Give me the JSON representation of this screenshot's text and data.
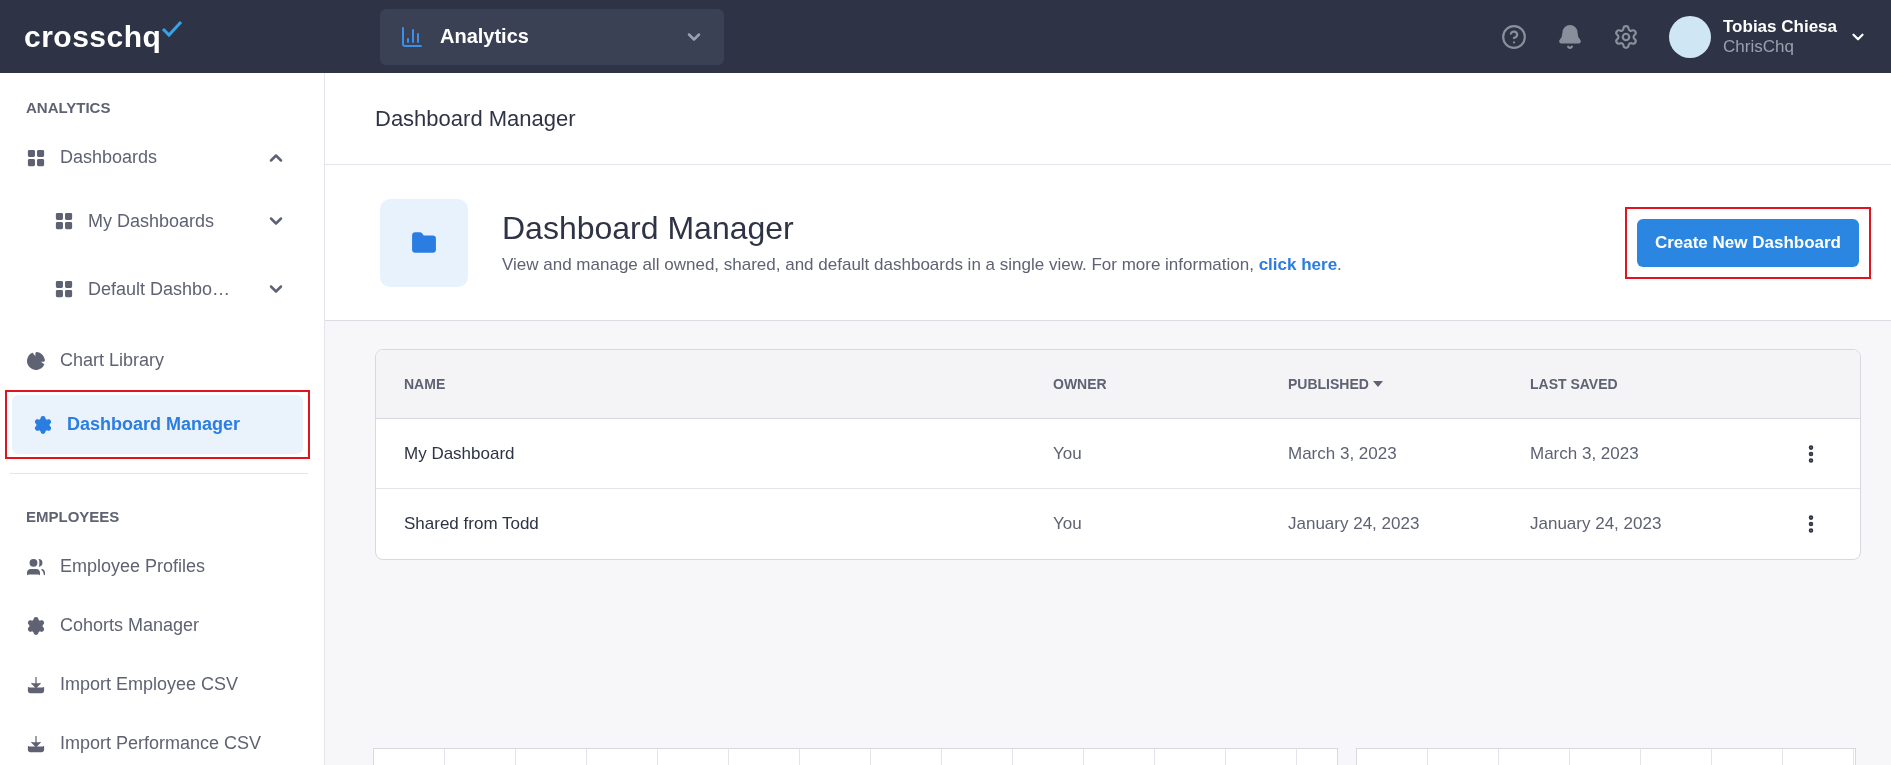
{
  "topbar": {
    "logo": "crosschq",
    "app_switcher": {
      "label": "Analytics"
    },
    "user": {
      "name": "Tobias Chiesa",
      "account": "ChrisChq"
    }
  },
  "sidebar": {
    "sections": [
      {
        "heading": "ANALYTICS",
        "items": [
          {
            "label": "Dashboards",
            "kind": "grid",
            "expanded": true,
            "selected": false,
            "highlighted": false,
            "children": [
              {
                "label": "My Dashboards",
                "kind": "grid",
                "expanded": false,
                "selected": false,
                "highlighted": false
              },
              {
                "label": "Default Dashbo…",
                "kind": "grid",
                "expanded": false,
                "selected": false,
                "highlighted": false
              }
            ]
          },
          {
            "label": "Chart Library",
            "kind": "pie",
            "selected": false,
            "highlighted": false
          },
          {
            "label": "Dashboard Manager",
            "kind": "gear",
            "selected": true,
            "highlighted": true
          }
        ]
      },
      {
        "heading": "EMPLOYEES",
        "items": [
          {
            "label": "Employee Profiles",
            "kind": "users",
            "selected": false,
            "highlighted": false
          },
          {
            "label": "Cohorts Manager",
            "kind": "gear",
            "selected": false,
            "highlighted": false
          },
          {
            "label": "Import Employee CSV",
            "kind": "download",
            "selected": false,
            "highlighted": false
          },
          {
            "label": "Import Performance CSV",
            "kind": "download",
            "selected": false,
            "highlighted": false
          }
        ]
      }
    ]
  },
  "page_title": "Dashboard Manager",
  "hero": {
    "title": "Dashboard Manager",
    "description": "View and manage all owned, shared, and default dashboards in a single view. For more information, ",
    "link": "click here",
    "trailing": ".",
    "button": {
      "label": "Create New Dashboard",
      "highlighted": true
    }
  },
  "table": {
    "columns": [
      {
        "label": "NAME",
        "sorted": false
      },
      {
        "label": "OWNER",
        "sorted": false
      },
      {
        "label": "PUBLISHED",
        "sorted": true
      },
      {
        "label": "LAST SAVED",
        "sorted": false
      }
    ],
    "rows": [
      {
        "cells": [
          "My Dashboard",
          "You",
          "March 3, 2023",
          "March 3, 2023"
        ]
      },
      {
        "cells": [
          "Shared from Todd",
          "You",
          "January 24, 2023",
          "January 24, 2023"
        ]
      }
    ]
  }
}
